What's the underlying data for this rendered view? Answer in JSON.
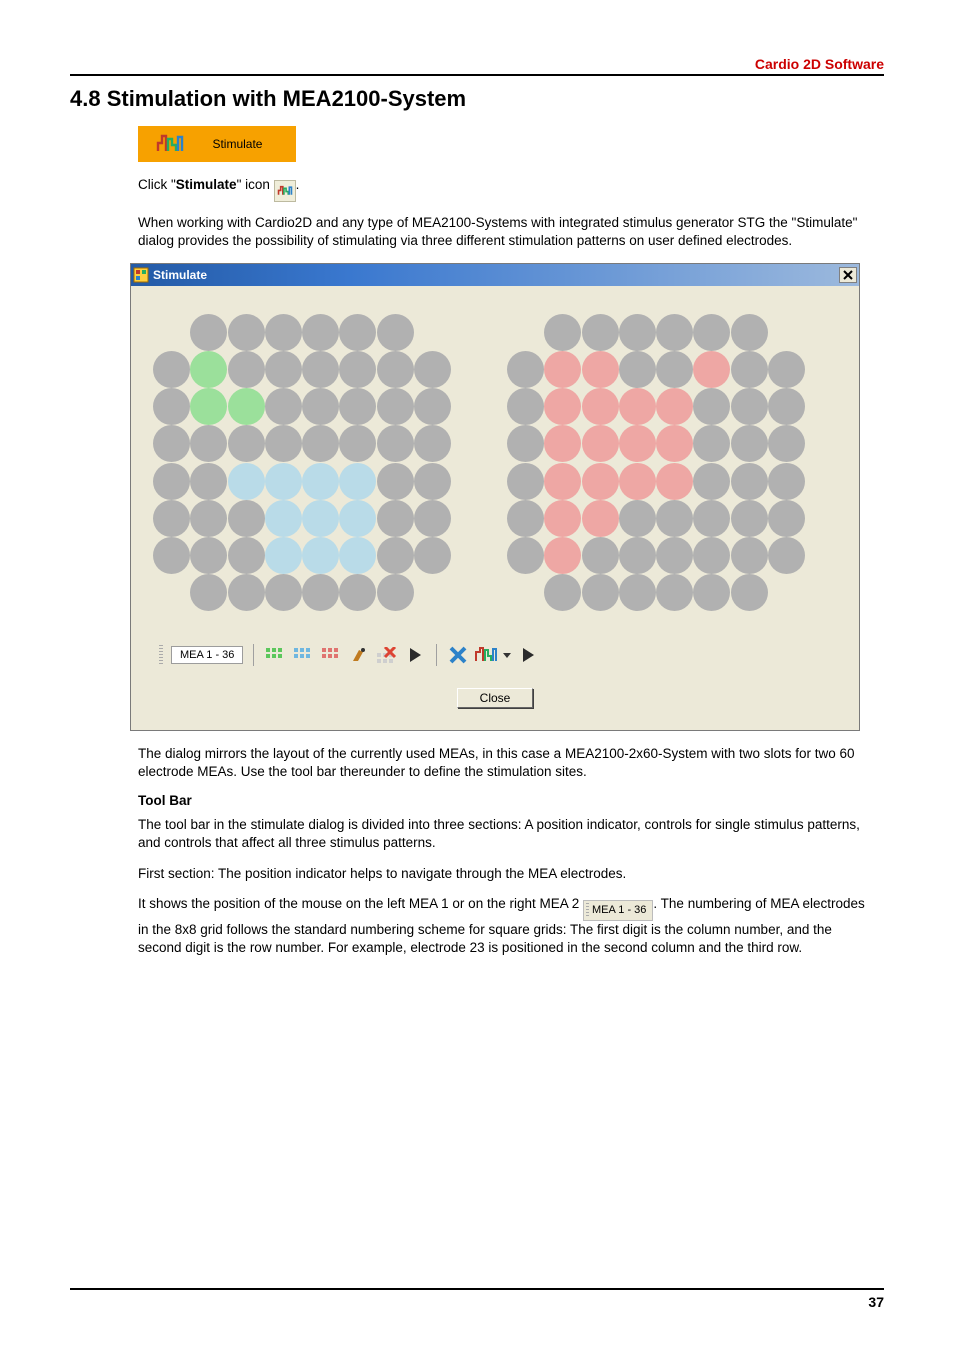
{
  "header": {
    "product": "Cardio 2D Software"
  },
  "section": {
    "number_title": "4.8   Stimulation with MEA2100-System"
  },
  "stim_tab": {
    "label": "Stimulate"
  },
  "click_line": {
    "pre": "Click \"",
    "word": "Stimulate",
    "post": "\" icon ",
    "tail": "."
  },
  "para_intro": "When working with Cardio2D and any type of MEA2100-Systems with integrated stimulus generator STG the \"Stimulate\" dialog provides the possibility of stimulating via three different stimulation patterns on user defined electrodes.",
  "dialog": {
    "title": "Stimulate",
    "toolbar_pos": "MEA 1 - 36",
    "close_button": "Close"
  },
  "grid_left": {
    "green": [
      "22",
      "23",
      "33"
    ],
    "blue": [
      "45",
      "46",
      "47",
      "55",
      "56",
      "57",
      "65",
      "66",
      "67",
      "35"
    ]
  },
  "grid_right": {
    "red": [
      "22",
      "23",
      "24",
      "25",
      "26",
      "32",
      "33",
      "34",
      "35",
      "36",
      "43",
      "44",
      "45",
      "53",
      "54",
      "55",
      "62",
      "27"
    ]
  },
  "para_after_dialog": "The dialog mirrors the layout of the currently used MEAs, in this case a MEA2100-2x60-System with two slots for two 60 electrode MEAs. Use the tool bar thereunder to define the stimulation sites.",
  "toolbar_heading": "Tool Bar",
  "para_toolbar_1": "The tool bar in the stimulate dialog is divided into three sections: A position indicator, controls for single stimulus patterns, and controls that affect all three stimulus patterns.",
  "para_toolbar_2": "First section: The position indicator helps to navigate through the MEA electrodes.",
  "inline_pos_label": "MEA 1 - 36",
  "para_last_pre": "It shows the position of the mouse on the left MEA 1 or on the right MEA 2 ",
  "para_last_post": ". The numbering of MEA electrodes in the 8x8 grid follows the standard numbering scheme for square grids: The first digit is the column number, and the second digit is the row number. For example, electrode 23 is positioned in the second column and the third row.",
  "footer": {
    "page": "37"
  },
  "icons": {
    "stimulate": "stimulate-icon",
    "stimulate_small": "stimulate-icon",
    "close_x": "close-icon",
    "grid_green": "pattern-green-icon",
    "grid_blue": "pattern-blue-icon",
    "grid_red": "pattern-red-icon",
    "flask": "paint-selection-icon",
    "erase_one": "clear-selection-icon",
    "play_small": "play-pattern-icon",
    "erase_all": "clear-all-icon",
    "pulse": "open-stimulus-icon",
    "play_big": "play-all-icon",
    "titlebar_app": "app-icon"
  }
}
